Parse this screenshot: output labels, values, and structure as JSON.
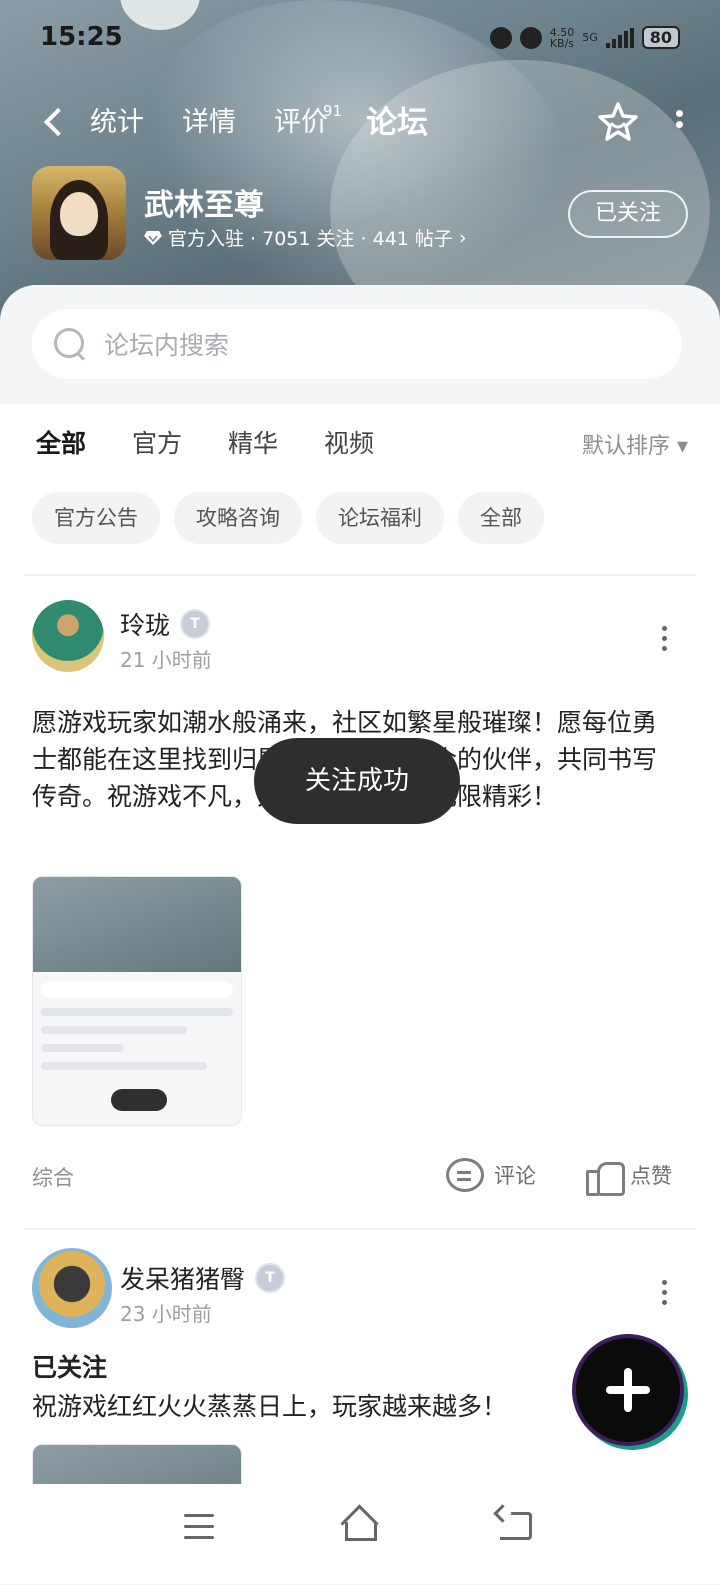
{
  "status": {
    "time": "15:25",
    "net_speed": "4.50\nKB/s",
    "net_type": "5G",
    "battery": "80"
  },
  "nav": {
    "tabs": [
      {
        "label": "统计",
        "active": false
      },
      {
        "label": "详情",
        "active": false
      },
      {
        "label": "评价",
        "active": false,
        "badge": "91"
      },
      {
        "label": "论坛",
        "active": true
      }
    ]
  },
  "game": {
    "name": "武林至尊",
    "meta": "官方入驻 · 7051 关注 · 441 帖子",
    "follow_label": "已关注"
  },
  "search": {
    "placeholder": "论坛内搜索"
  },
  "categories": [
    "全部",
    "官方",
    "精华",
    "视频"
  ],
  "sort_label": "默认排序",
  "chips": [
    "官方公告",
    "攻略咨询",
    "论坛福利",
    "全部"
  ],
  "posts": [
    {
      "user": "玲珑",
      "time": "21 小时前",
      "text": "愿游戏玩家如潮水般涌来，社区如繁星般璀璨！愿每位勇士都能在这里找到归属，结识志同道合的伙伴，共同书写传奇。祝游戏不凡，人气旺旺，未来无限精彩！",
      "type": "综合",
      "comment_label": "评论",
      "like_label": "点赞"
    },
    {
      "user": "发呆猪猪臀",
      "time": "23 小时前",
      "title": "已关注",
      "text": "祝游戏红红火火蒸蒸日上，玩家越来越多！"
    }
  ],
  "toast": "关注成功",
  "colors": {
    "accent": "#2fd4b0",
    "header": "#6f858f"
  }
}
